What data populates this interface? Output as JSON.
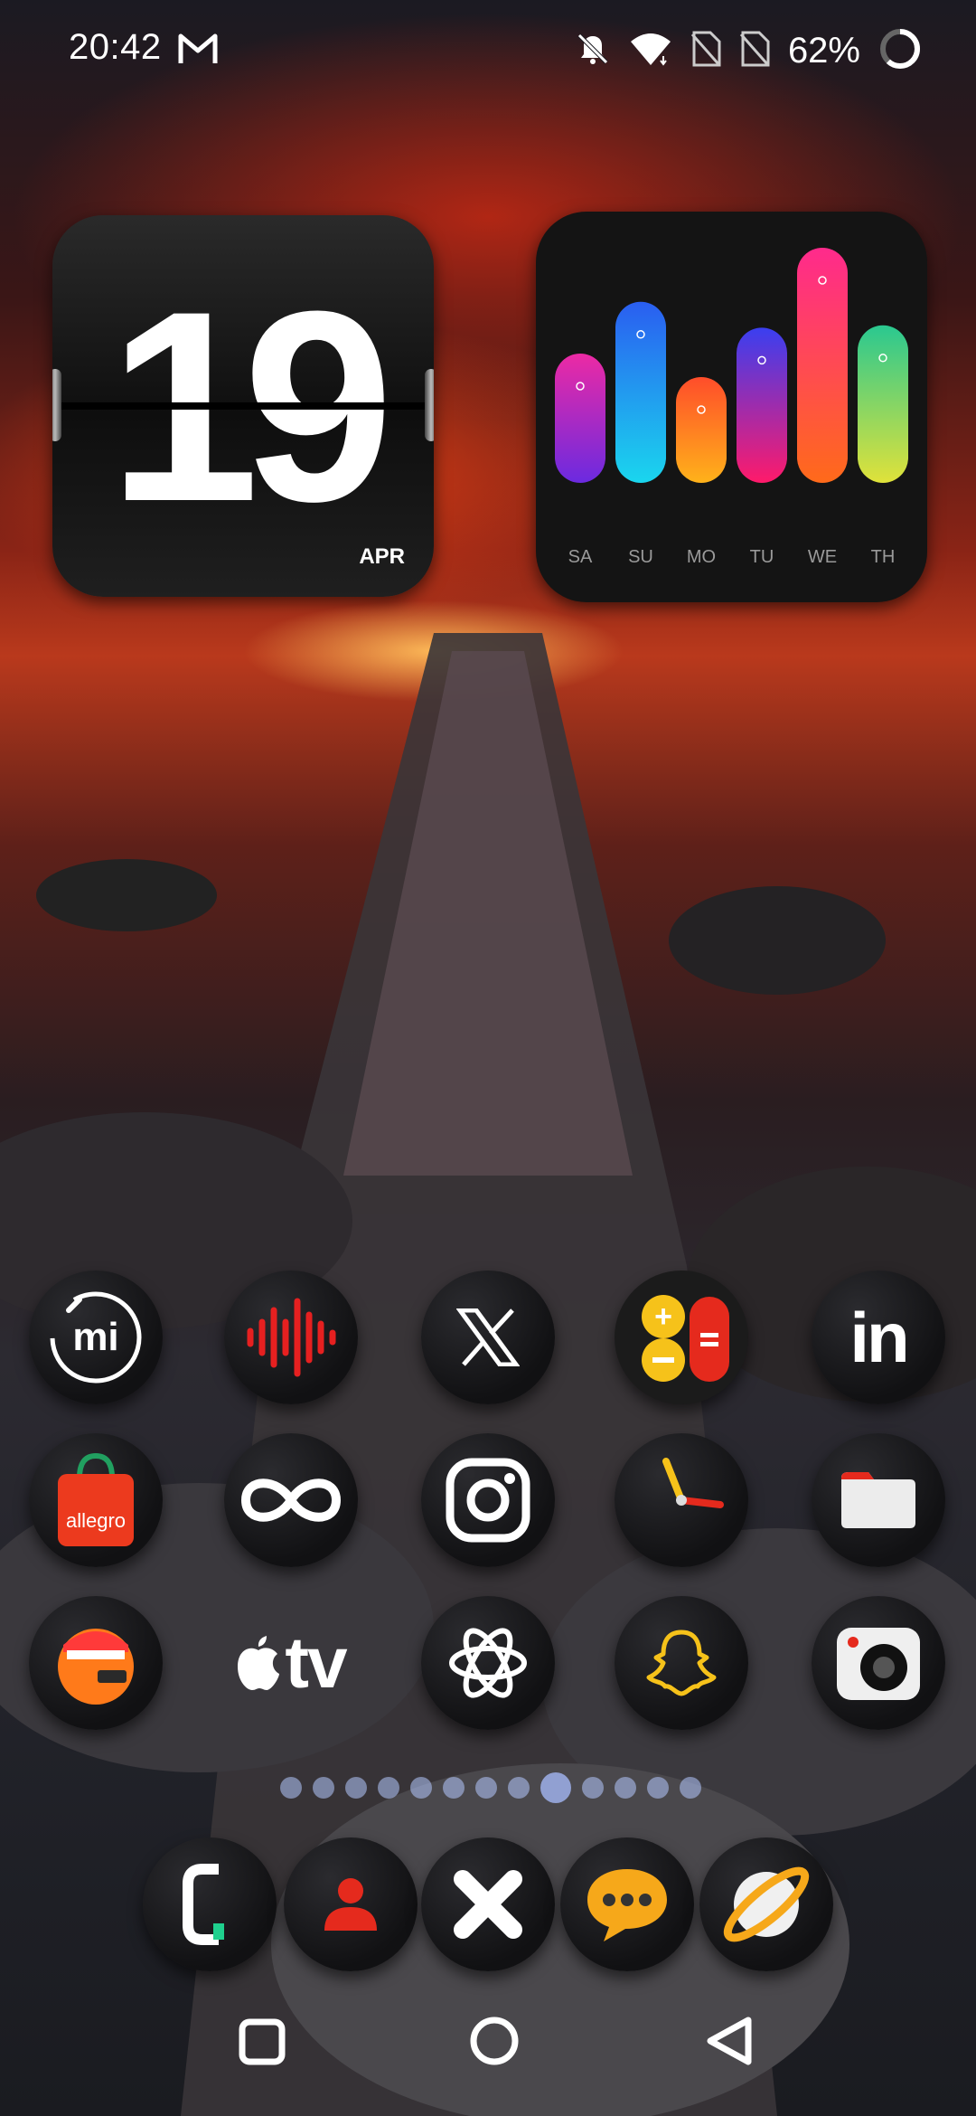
{
  "status_bar": {
    "time": "20:42",
    "battery_percent": "62%",
    "icons": [
      "gmail-icon",
      "dnd-icon",
      "wifi-icon",
      "no-sim-icon",
      "no-sim-icon",
      "battery-ring-icon"
    ]
  },
  "date_widget": {
    "day": "19",
    "month": "APR"
  },
  "week_widget": {
    "days": [
      "SA",
      "SU",
      "MO",
      "TU",
      "WE",
      "TH"
    ],
    "levels": [
      0.55,
      0.77,
      0.45,
      0.66,
      1.0,
      0.67
    ],
    "colors": [
      [
        "#ec2aa4",
        "#6b2ae0"
      ],
      [
        "#2a5ef0",
        "#1ad6ee"
      ],
      [
        "#ff4d2a",
        "#ffb21a"
      ],
      [
        "#3a3ff0",
        "#ff1a6a"
      ],
      [
        "#ff2a8c",
        "#ff6a1a"
      ],
      [
        "#2ac890",
        "#e0e23a"
      ]
    ]
  },
  "apps": [
    {
      "name": "xiaomi-icon",
      "text": "mi"
    },
    {
      "name": "sound-recorder-icon",
      "text": ""
    },
    {
      "name": "x-twitter-icon",
      "text": "X"
    },
    {
      "name": "calculator-icon",
      "text": ""
    },
    {
      "name": "linkedin-icon",
      "text": "in"
    },
    {
      "name": "allegro-icon",
      "text": "allegro"
    },
    {
      "name": "infinity-icon",
      "text": ""
    },
    {
      "name": "instagram-icon",
      "text": ""
    },
    {
      "name": "clock-icon",
      "text": ""
    },
    {
      "name": "folder-icon",
      "text": ""
    },
    {
      "name": "file-manager-icon",
      "text": ""
    },
    {
      "name": "apple-tv-icon",
      "text": "tv"
    },
    {
      "name": "chatgpt-icon",
      "text": ""
    },
    {
      "name": "snapchat-icon",
      "text": ""
    },
    {
      "name": "camera-icon",
      "text": ""
    }
  ],
  "page_dots": {
    "count": 13,
    "active": 8
  },
  "dock": [
    "phone-icon",
    "contacts-icon",
    "close-x-icon",
    "messages-icon",
    "browser-icon"
  ]
}
